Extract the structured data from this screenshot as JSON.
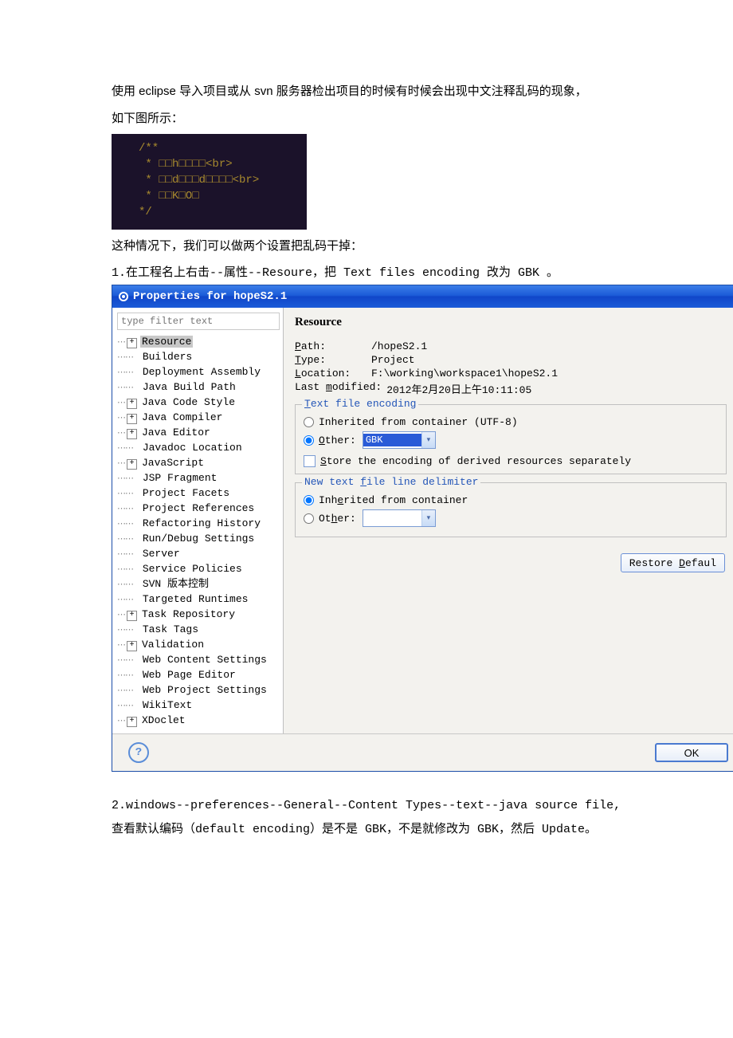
{
  "intro1": "使用 eclipse 导入项目或从 svn 服务器检出项目的时候有时候会出现中文注释乱码的现象，",
  "intro2": "如下图所示：",
  "code": {
    "l1": "/**",
    "l2": "* □□h□□□□<br>",
    "l3": "* □□d□□□d□□□□<br>",
    "l4": "* □□K□O□",
    "l5": "*/"
  },
  "para2": "这种情况下，我们可以做两个设置把乱码干掉：",
  "step1": "1.在工程名上右击--属性--Resoure，把 Text files encoding 改为 GBK 。",
  "dialog": {
    "title": "Properties for hopeS2.1",
    "filter_ph": "type filter text",
    "section": "Resource",
    "path_k": "Path:",
    "path_v": "/hopeS2.1",
    "type_k": "Type:",
    "type_v": "Project",
    "loc_k": "Location:",
    "loc_v": "F:\\working\\workspace1\\hopeS2.1",
    "mod_k": "Last modified:",
    "mod_v": "2012年2月20日上午10:11:05",
    "enc_legend": "Text file encoding",
    "inh_label": "Inherited from container (UTF-8)",
    "other_label": "Other:",
    "other_val": "GBK",
    "store": "Store the encoding of derived resources separately",
    "delim_legend": "New text file line delimiter",
    "delim_inh": "Inherited from container",
    "delim_other": "Other:",
    "restore": "Restore Defaul",
    "ok": "OK"
  },
  "tree": [
    {
      "exp": "+",
      "label": "Resource",
      "sel": true
    },
    {
      "ind": 1,
      "label": "Builders"
    },
    {
      "ind": 1,
      "label": "Deployment Assembly"
    },
    {
      "ind": 1,
      "label": "Java Build Path"
    },
    {
      "exp": "+",
      "label": "Java Code Style"
    },
    {
      "exp": "+",
      "label": "Java Compiler"
    },
    {
      "exp": "+",
      "label": "Java Editor"
    },
    {
      "ind": 1,
      "label": "Javadoc Location"
    },
    {
      "exp": "+",
      "label": "JavaScript"
    },
    {
      "ind": 1,
      "label": "JSP Fragment"
    },
    {
      "ind": 1,
      "label": "Project Facets"
    },
    {
      "ind": 1,
      "label": "Project References"
    },
    {
      "ind": 1,
      "label": "Refactoring History"
    },
    {
      "ind": 1,
      "label": "Run/Debug Settings"
    },
    {
      "ind": 1,
      "label": "Server"
    },
    {
      "ind": 1,
      "label": "Service Policies"
    },
    {
      "ind": 1,
      "label": "SVN 版本控制"
    },
    {
      "ind": 1,
      "label": "Targeted Runtimes"
    },
    {
      "exp": "+",
      "label": "Task Repository"
    },
    {
      "ind": 1,
      "label": "Task Tags"
    },
    {
      "exp": "+",
      "label": "Validation"
    },
    {
      "ind": 1,
      "label": "Web Content Settings"
    },
    {
      "ind": 1,
      "label": "Web Page Editor"
    },
    {
      "ind": 1,
      "label": "Web Project Settings"
    },
    {
      "ind": 1,
      "label": "WikiText"
    },
    {
      "exp": "+",
      "label": "XDoclet"
    }
  ],
  "step2a": "2.windows--preferences--General--Content Types--text--java source file,",
  "step2b": "查看默认编码（default encoding）是不是 GBK，不是就修改为 GBK，然后 Update。"
}
